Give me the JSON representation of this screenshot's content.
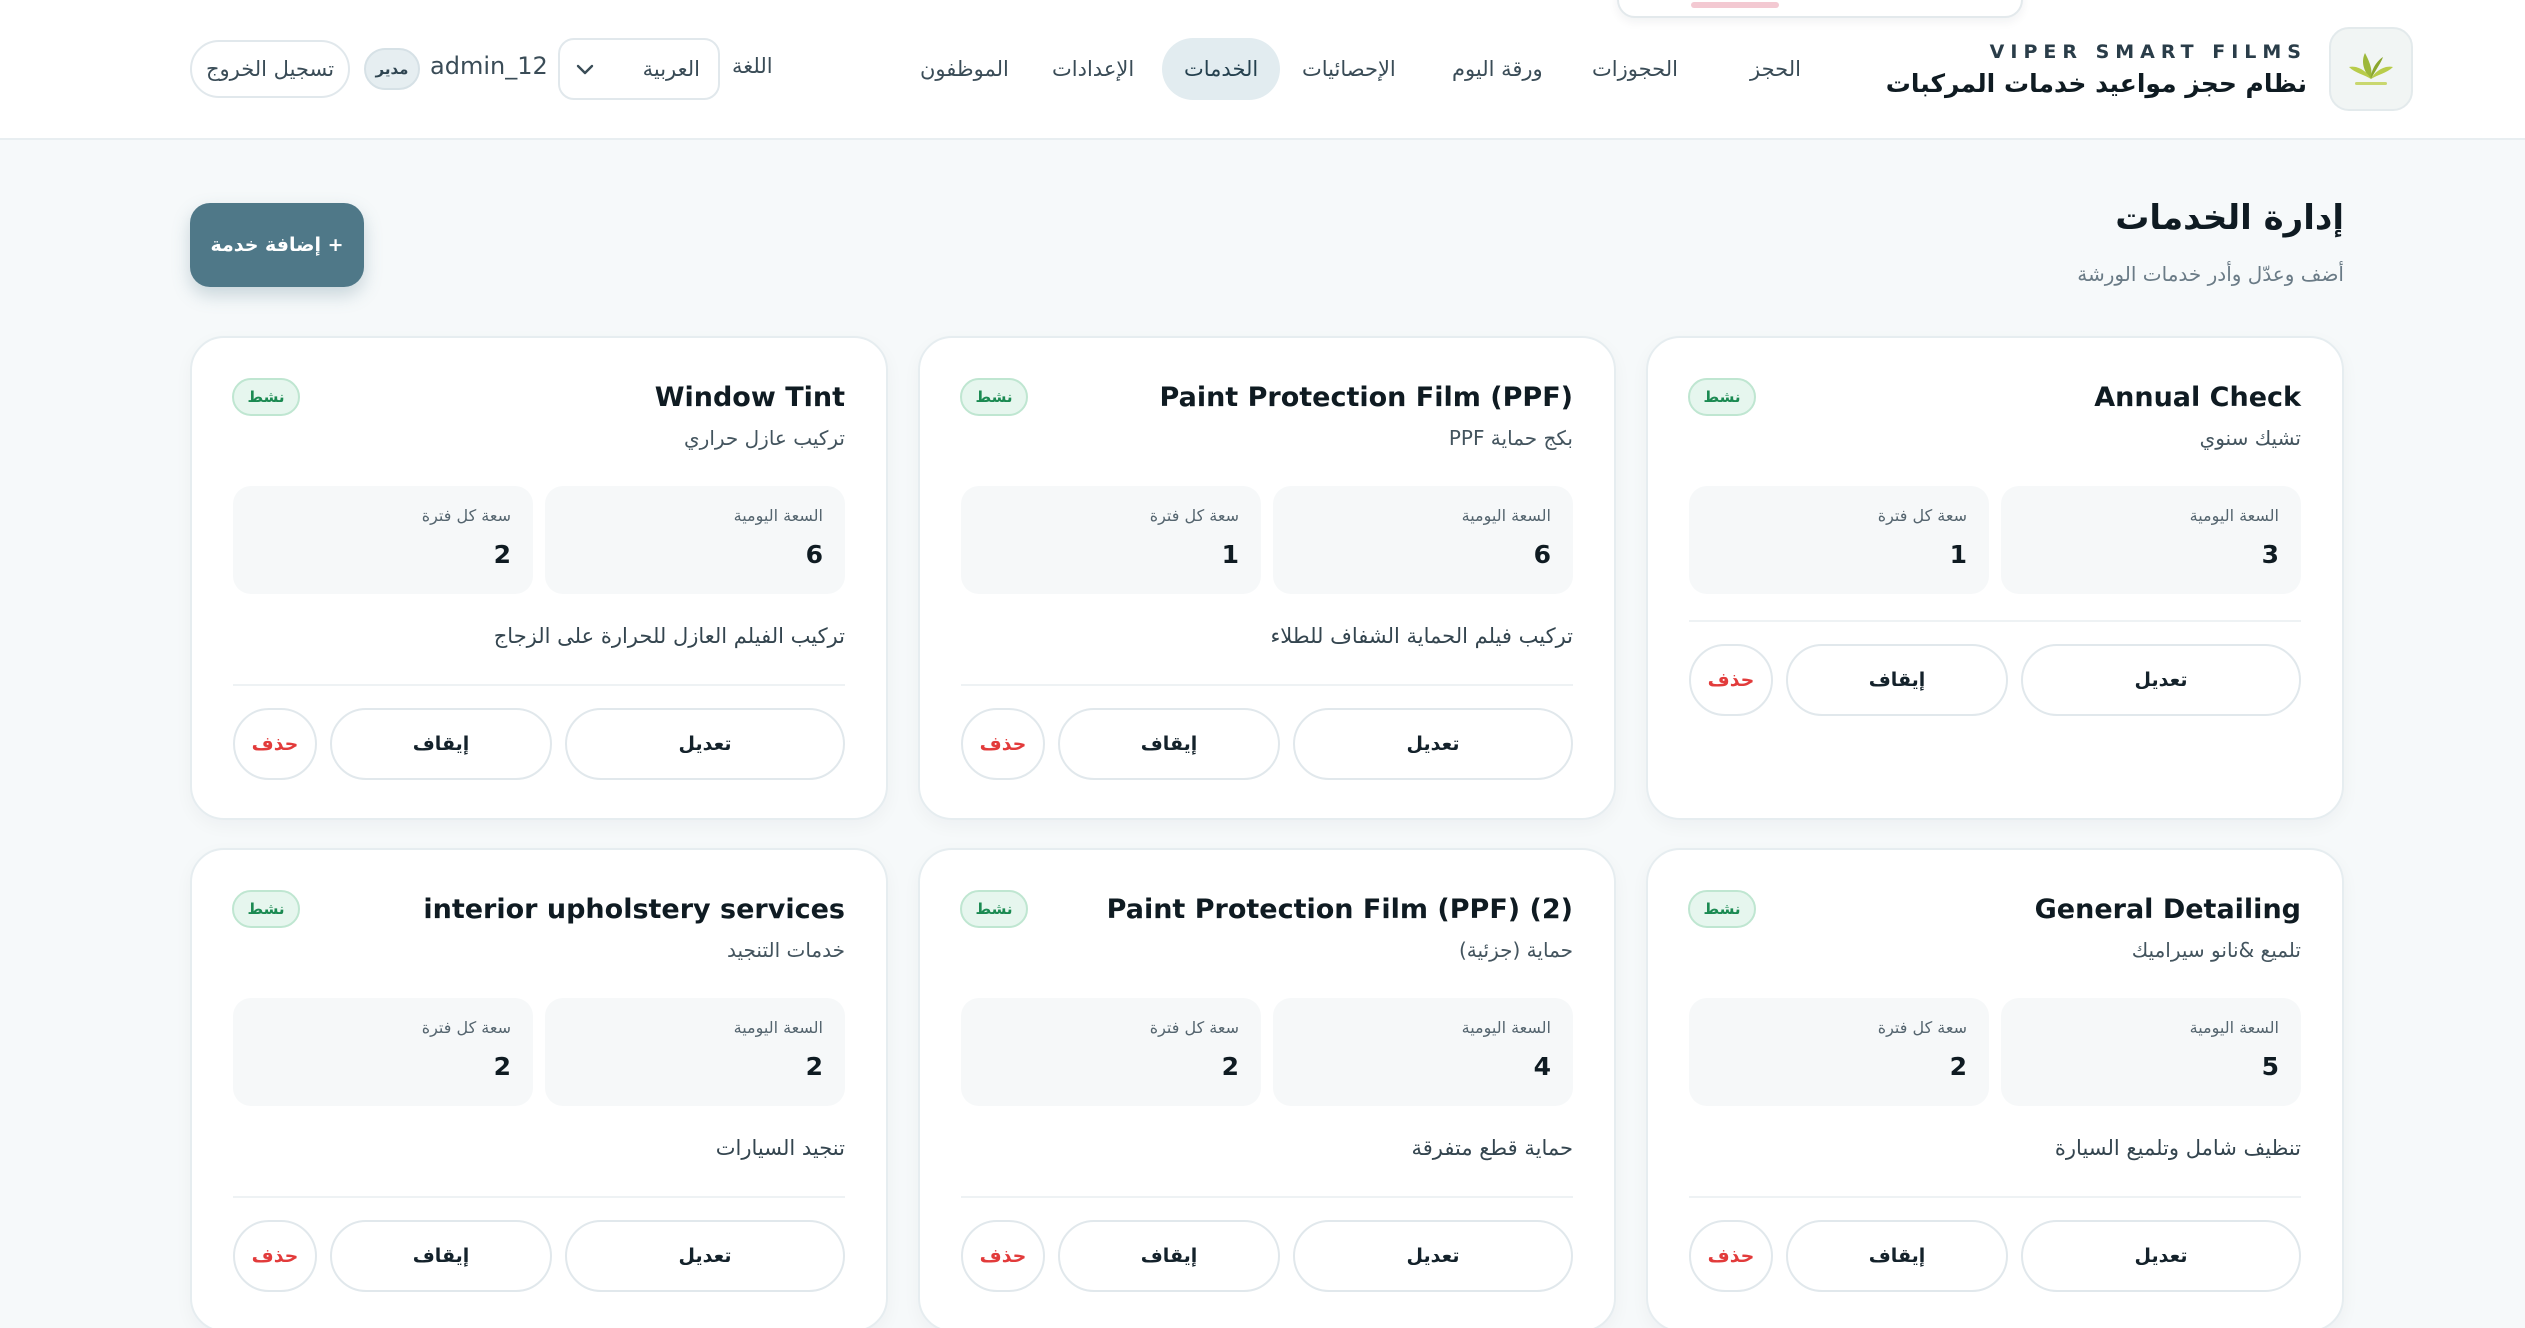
{
  "brand": {
    "subtitle": "VIPER SMART FILMS",
    "title": "نظام حجز مواعيد خدمات المركبات",
    "logo_icon": "viper-leaf-logo-icon",
    "accent": "#4f7888"
  },
  "nav": {
    "items": [
      {
        "label": "الحجز"
      },
      {
        "label": "الحجوزات"
      },
      {
        "label": "ورقة اليوم"
      },
      {
        "label": "الإحصائيات"
      },
      {
        "label": "الخدمات",
        "active": true
      },
      {
        "label": "الإعدادات"
      },
      {
        "label": "الموظفون"
      }
    ]
  },
  "header_controls": {
    "language_label": "اللغة",
    "language_value": "العربية",
    "username": "admin_12",
    "role": "مدير",
    "logout_label": "تسجيل الخروج"
  },
  "page": {
    "title": "إدارة الخدمات",
    "subtitle": "أضف وعدّل وأدر خدمات الورشة",
    "add_button": "+ إضافة خدمة"
  },
  "labels": {
    "daily_capacity": "السعة اليومية",
    "slot_capacity": "سعة كل فترة",
    "status_active": "نشط",
    "edit": "تعديل",
    "pause": "إيقاف",
    "delete": "حذف"
  },
  "services": [
    {
      "name": "Annual Check",
      "subname": "تشيك سنوي",
      "daily": "3",
      "slot": "1",
      "description": "",
      "status": "نشط"
    },
    {
      "name": "Paint Protection Film (PPF)",
      "subname": "بكج حماية PPF",
      "daily": "6",
      "slot": "1",
      "description": "تركيب فيلم الحماية الشفاف للطلاء",
      "status": "نشط"
    },
    {
      "name": "Window Tint",
      "subname": "تركيب عازل حراري",
      "daily": "6",
      "slot": "2",
      "description": "تركيب الفيلم العازل للحرارة على الزجاج",
      "status": "نشط"
    },
    {
      "name": "General Detailing",
      "subname": "تلميع &نانو سيراميك",
      "daily": "5",
      "slot": "2",
      "description": "تنظيف شامل وتلميع السيارة",
      "status": "نشط"
    },
    {
      "name": "Paint Protection Film (PPF) (2)",
      "subname": "حماية (جزئية)",
      "daily": "4",
      "slot": "2",
      "description": "حماية قطع متفرقة",
      "status": "نشط"
    },
    {
      "name": "interior upholstery services",
      "subname": "خدمات التنجيد",
      "daily": "2",
      "slot": "2",
      "description": "تنجيد السيارات",
      "status": "نشط"
    }
  ]
}
